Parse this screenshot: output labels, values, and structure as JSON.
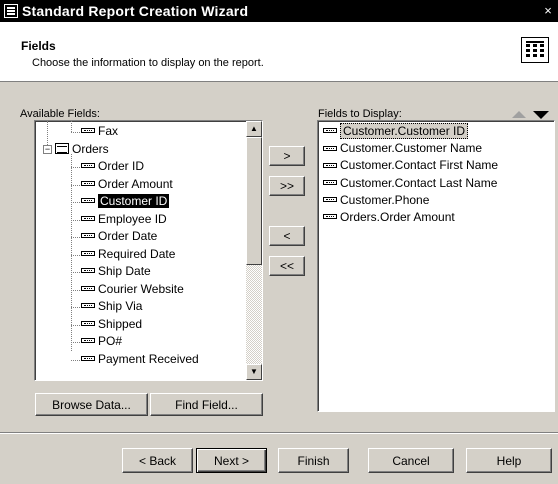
{
  "window": {
    "title": "Standard Report Creation Wizard",
    "close_glyph": "×"
  },
  "header": {
    "title": "Fields",
    "subtitle": "Choose the information to display on the report.",
    "icon": "report-grid-icon"
  },
  "available": {
    "label": "Available Fields:",
    "items": [
      {
        "label": "Fax",
        "kind": "field"
      },
      {
        "label": "Orders",
        "kind": "table"
      },
      {
        "label": "Order ID",
        "kind": "field"
      },
      {
        "label": "Order Amount",
        "kind": "field"
      },
      {
        "label": "Customer ID",
        "kind": "field",
        "selected": true
      },
      {
        "label": "Employee ID",
        "kind": "field"
      },
      {
        "label": "Order Date",
        "kind": "field"
      },
      {
        "label": "Required Date",
        "kind": "field"
      },
      {
        "label": "Ship Date",
        "kind": "field"
      },
      {
        "label": "Courier Website",
        "kind": "field"
      },
      {
        "label": "Ship Via",
        "kind": "field"
      },
      {
        "label": "Shipped",
        "kind": "field"
      },
      {
        "label": "PO#",
        "kind": "field"
      },
      {
        "label": "Payment Received",
        "kind": "field"
      }
    ],
    "expander_glyph": "−"
  },
  "display": {
    "label": "Fields to Display:",
    "items": [
      {
        "label": "Customer.Customer ID",
        "focused": true
      },
      {
        "label": "Customer.Customer Name"
      },
      {
        "label": "Customer.Contact First Name"
      },
      {
        "label": "Customer.Contact Last Name"
      },
      {
        "label": "Customer.Phone"
      },
      {
        "label": "Orders.Order Amount"
      }
    ]
  },
  "transfer": {
    "add_one": ">",
    "add_all": ">>",
    "remove_one": "<",
    "remove_all": "<<"
  },
  "actions": {
    "browse_data": "Browse Data...",
    "find_field": "Find Field..."
  },
  "footer": {
    "back": "< Back",
    "next": "Next >",
    "finish": "Finish",
    "cancel": "Cancel",
    "help": "Help"
  },
  "scroll": {
    "up_glyph": "▲",
    "down_glyph": "▼"
  }
}
